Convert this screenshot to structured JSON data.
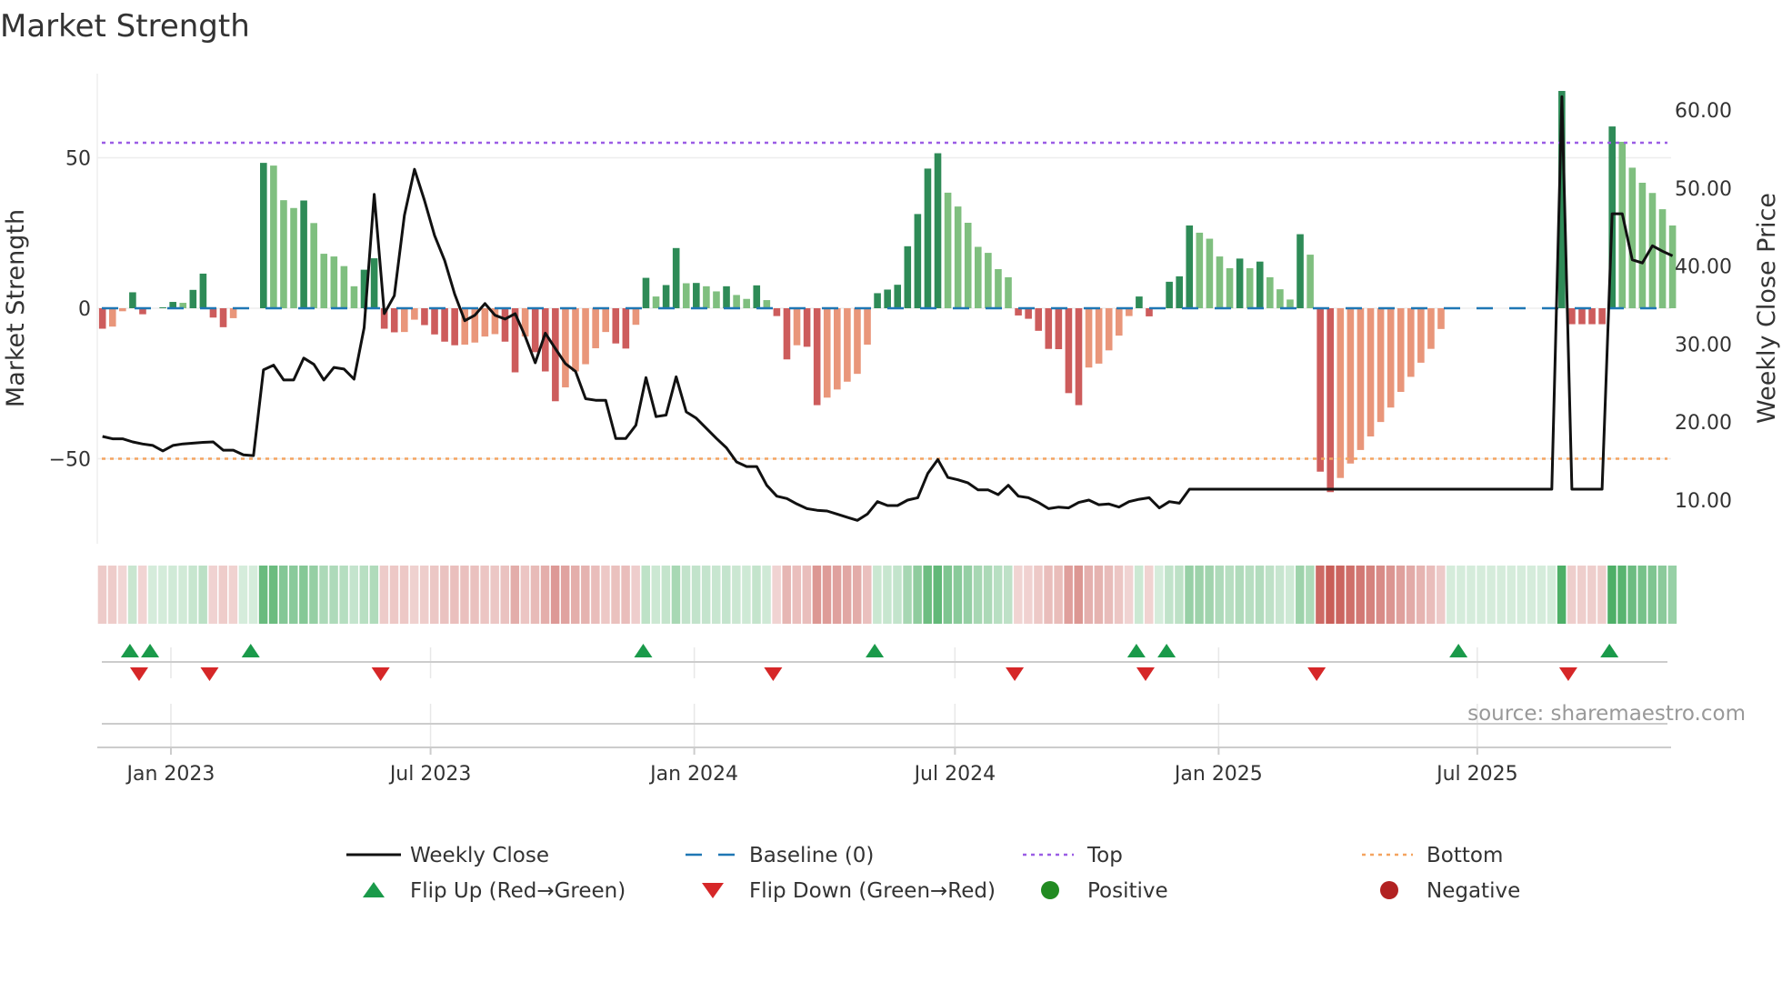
{
  "chart_data": {
    "type": "bar",
    "title": "Market Strength",
    "ylabel": "Market Strength",
    "y2label": "Weekly Close Price",
    "ylim": [
      -80,
      75
    ],
    "y2lim": [
      5,
      65
    ],
    "x_unit": "week index (weekly, ~Nov 2022 to Nov 2025)",
    "y_ticks": [
      {
        "value": 50,
        "label": "50"
      },
      {
        "value": 0,
        "label": "0"
      },
      {
        "value": -50,
        "label": "−50"
      }
    ],
    "y2_ticks": [
      {
        "value": 60,
        "label": "60.00"
      },
      {
        "value": 50,
        "label": "50.00"
      },
      {
        "value": 40,
        "label": "40.00"
      },
      {
        "value": 30,
        "label": "30.00"
      },
      {
        "value": 20,
        "label": "20.00"
      },
      {
        "value": 10,
        "label": "10.00"
      }
    ],
    "x_ticks": [
      {
        "week": 6.8,
        "label": "Jan 2023"
      },
      {
        "week": 32.6,
        "label": "Jul 2023"
      },
      {
        "week": 58.8,
        "label": "Jan 2024"
      },
      {
        "week": 84.7,
        "label": "Jul 2024"
      },
      {
        "week": 110.9,
        "label": "Jan 2025"
      },
      {
        "week": 136.6,
        "label": "Jul 2025"
      }
    ],
    "thresholds": {
      "baseline": 0,
      "top": 55,
      "bottom": -50
    },
    "strength": [
      -6.8,
      -6.1,
      -1,
      5.3,
      -2,
      0,
      0.3,
      2.1,
      1.8,
      6.1,
      11.5,
      -3.1,
      -6.3,
      -3.3,
      0,
      0,
      48.3,
      47.4,
      35.9,
      33.3,
      35.8,
      28.3,
      18.1,
      17.2,
      14,
      7.3,
      12.8,
      16.6,
      -6.8,
      -8,
      -7.9,
      -3.8,
      -5.6,
      -8.7,
      -11.1,
      -12.3,
      -12.1,
      -11.4,
      -9.4,
      -8.6,
      -11.1,
      -21.3,
      -9.4,
      -14.6,
      -21,
      -30.9,
      -26.3,
      -21,
      -18.6,
      -13.3,
      -7.9,
      -11.7,
      -13.4,
      -5.5,
      10.1,
      3.9,
      7.7,
      20,
      8.3,
      8.4,
      7.3,
      5.6,
      7.3,
      4.4,
      3.1,
      7.6,
      2.7,
      -2.6,
      -17,
      -12.3,
      -12.8,
      -32.2,
      -29.7,
      -27,
      -24.4,
      -21.8,
      -12.1,
      5,
      6.2,
      7.8,
      20.6,
      31.3,
      46.4,
      51.5,
      38.4,
      33.8,
      28.4,
      20.4,
      18.4,
      13,
      10.3,
      -2.4,
      -3.5,
      -7.5,
      -13.5,
      -13.6,
      -28.2,
      -32.2,
      -19.7,
      -18.4,
      -14,
      -9.1,
      -2.6,
      3.9,
      -2.7,
      0,
      8.8,
      10.6,
      27.5,
      25.1,
      23.1,
      17.2,
      13.3,
      16.5,
      13.3,
      15.5,
      10.3,
      6.3,
      2.9,
      24.6,
      17.8,
      -54.3,
      -61.1,
      -56.4,
      -51.6,
      -47.1,
      -42.6,
      -37.8,
      -33,
      -27.8,
      -22.8,
      -18.1,
      -13.5,
      -6.9,
      0,
      0,
      0,
      0,
      0,
      0,
      0,
      0,
      0,
      0,
      0,
      72.2,
      -5.3,
      -5.3,
      -5.3,
      -5.3,
      60.4,
      55.3,
      46.7,
      41.7,
      38.3,
      32.9,
      27.5
    ],
    "weekly_close": [
      18.16,
      17.85,
      17.85,
      17.46,
      17.19,
      17.0,
      16.3,
      17.0,
      17.2,
      17.3,
      17.4,
      17.46,
      16.4,
      16.4,
      15.8,
      15.7,
      26.7,
      27.3,
      25.4,
      25.4,
      28.2,
      27.4,
      25.4,
      27.0,
      26.8,
      25.5,
      32.1,
      49.2,
      33.9,
      36.2,
      46.5,
      52.4,
      48.4,
      43.9,
      40.7,
      36.4,
      33.0,
      33.7,
      35.2,
      33.7,
      33.2,
      33.9,
      31.0,
      27.6,
      31.4,
      29.4,
      27.5,
      26.5,
      23.0,
      22.8,
      22.8,
      17.9,
      17.9,
      19.6,
      25.7,
      20.7,
      20.9,
      25.8,
      21.3,
      20.5,
      19.2,
      17.9,
      16.7,
      14.9,
      14.3,
      14.3,
      11.9,
      10.5,
      10.2,
      9.5,
      8.9,
      8.7,
      8.6,
      8.2,
      7.8,
      7.4,
      8.2,
      9.8,
      9.3,
      9.3,
      10.0,
      10.3,
      13.4,
      15.2,
      12.9,
      12.6,
      12.2,
      11.3,
      11.3,
      10.7,
      11.9,
      10.5,
      10.3,
      9.7,
      8.9,
      9.1,
      9.0,
      9.7,
      10.0,
      9.4,
      9.5,
      9.1,
      9.8,
      10.1,
      10.3,
      9.0,
      9.8,
      9.6,
      11.4,
      11.4,
      11.4,
      11.4,
      11.4,
      11.4,
      11.4,
      11.4,
      11.4,
      11.4,
      11.4,
      11.4,
      11.4,
      11.4,
      11.4,
      11.4,
      11.4,
      11.4,
      11.4,
      11.4,
      11.4,
      11.4,
      11.4,
      11.4,
      11.4,
      11.4,
      11.4,
      11.4,
      11.4,
      11.4,
      11.4,
      11.4,
      11.4,
      11.4,
      11.4,
      11.4,
      11.4,
      61.7,
      11.4,
      11.4,
      11.4,
      11.4,
      46.7,
      46.7,
      40.8,
      40.4,
      42.6,
      41.9,
      41.3
    ],
    "flip_up_weeks": [
      3,
      5,
      15,
      54,
      77,
      103,
      106,
      135,
      150
    ],
    "flip_down_weeks": [
      4,
      11,
      28,
      67,
      91,
      104,
      121,
      146
    ],
    "legend": {
      "placement": "bottom",
      "items": [
        {
          "key": "weekly_close",
          "label": "Weekly Close"
        },
        {
          "key": "baseline",
          "label": "Baseline (0)"
        },
        {
          "key": "top",
          "label": "Top"
        },
        {
          "key": "bottom",
          "label": "Bottom"
        },
        {
          "key": "flip_up",
          "label": "Flip Up (Red→Green)"
        },
        {
          "key": "flip_down",
          "label": "Flip Down (Green→Red)"
        },
        {
          "key": "positive",
          "label": "Positive"
        },
        {
          "key": "negative",
          "label": "Negative"
        }
      ]
    },
    "source": "source: sharemaestro.com",
    "colors": {
      "strong_positive": "#2e8b57",
      "weak_positive": "#7fbf7f",
      "strong_negative": "#cd5c5c",
      "weak_negative": "#e9967a",
      "weekly_close": "#111111",
      "baseline": "#1f77b4",
      "top": "#9b5de5",
      "bottom": "#f4a460",
      "flip_up": "#1a9a4a",
      "flip_down": "#d62728",
      "positive": "#228b22",
      "negative": "#b22222"
    }
  }
}
